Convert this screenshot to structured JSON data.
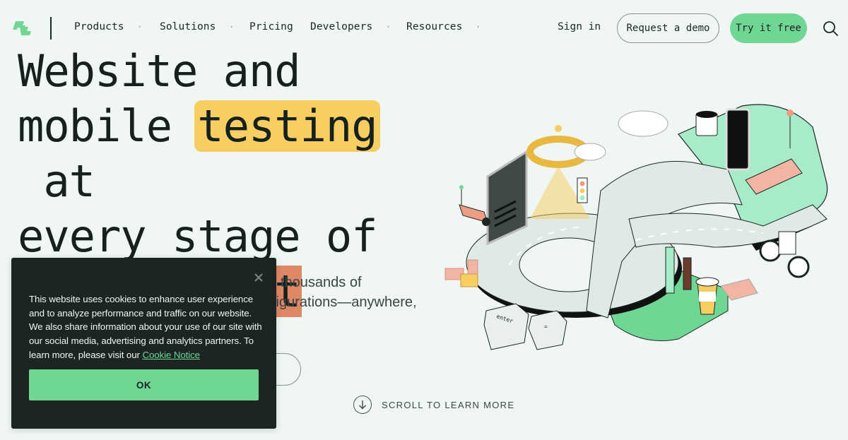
{
  "nav": {
    "items": [
      {
        "label": "Products",
        "has_dropdown": true
      },
      {
        "label": "Solutions",
        "has_dropdown": true
      },
      {
        "label": "Pricing",
        "has_dropdown": false
      },
      {
        "label": "Developers",
        "has_dropdown": true
      },
      {
        "label": "Resources",
        "has_dropdown": true
      }
    ],
    "dropdown_glyph": "▾",
    "sign_in": "Sign in",
    "request_demo": "Request a demo",
    "try_free": "Try it free",
    "search_icon": "search-icon"
  },
  "hero": {
    "title_line1": "Website and",
    "title_line2_pre": "mobile ",
    "title_highlight1": "testing",
    "title_line2_post": " at",
    "title_line3": "every stage of",
    "title_highlight2": "development",
    "subtitle_visible_line1": "thousands of",
    "subtitle_visible_line2": "figurations—anywhere,",
    "scroll_label": "SCROLL TO LEARN MORE",
    "scroll_icon": "arrow-down-icon"
  },
  "cookie_banner": {
    "text": "This website uses cookies to enhance user experience and to analyze performance and traffic on our website. We also share information about your use of our site with our social media, advertising and analytics partners. To learn more, please visit our ",
    "link_label": "Cookie Notice",
    "ok_label": "OK",
    "close_icon": "close-icon"
  },
  "colors": {
    "background": "#eff6f3",
    "brand_green": "#6fd694",
    "highlight_yellow": "#f6ce62",
    "highlight_orange": "#df8866",
    "dark": "#1b2624"
  },
  "illustration": {
    "keyboard_keys": [
      "enter",
      "="
    ],
    "semantic": "isometric-testing-pipeline-illustration"
  }
}
